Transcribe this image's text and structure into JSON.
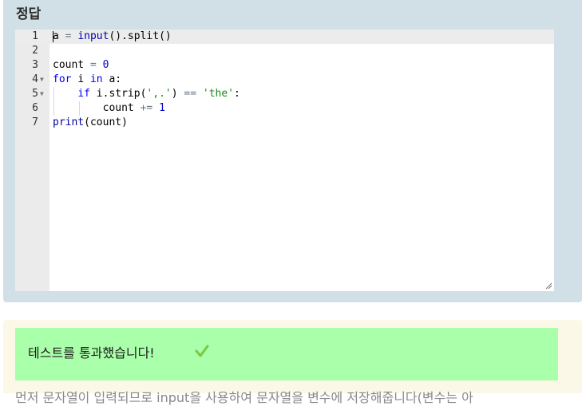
{
  "answer": {
    "title": "정답",
    "lines": [
      {
        "num": "1",
        "fold": false
      },
      {
        "num": "2",
        "fold": false
      },
      {
        "num": "3",
        "fold": false
      },
      {
        "num": "4",
        "fold": true
      },
      {
        "num": "5",
        "fold": true
      },
      {
        "num": "6",
        "fold": false
      },
      {
        "num": "7",
        "fold": false
      }
    ],
    "code": {
      "l1": {
        "var": "a",
        "eq": "=",
        "fn": "input",
        "rest": "().split()"
      },
      "l3": {
        "var": "count",
        "eq": "=",
        "num": "0"
      },
      "l4": {
        "kw1": "for",
        "var": "i",
        "kw2": "in",
        "rest": "a:"
      },
      "l5": {
        "kw": "if",
        "a": "i.strip(",
        "str1": "',.'",
        "b": ")",
        "op": "==",
        "str2": "'the'",
        "c": ":"
      },
      "l6": {
        "var": "count",
        "op": "+=",
        "num": "1"
      },
      "l7": {
        "fn": "print",
        "rest": "(count)"
      }
    }
  },
  "result": {
    "message": "테스트를 통과했습니다!",
    "check_icon": "checkmark-icon",
    "check_color": "#7ac943",
    "description": "먼저 문자열이 입력되므로 input을 사용하여 문자열을 변수에 저장해줍니다(변수는 아"
  }
}
